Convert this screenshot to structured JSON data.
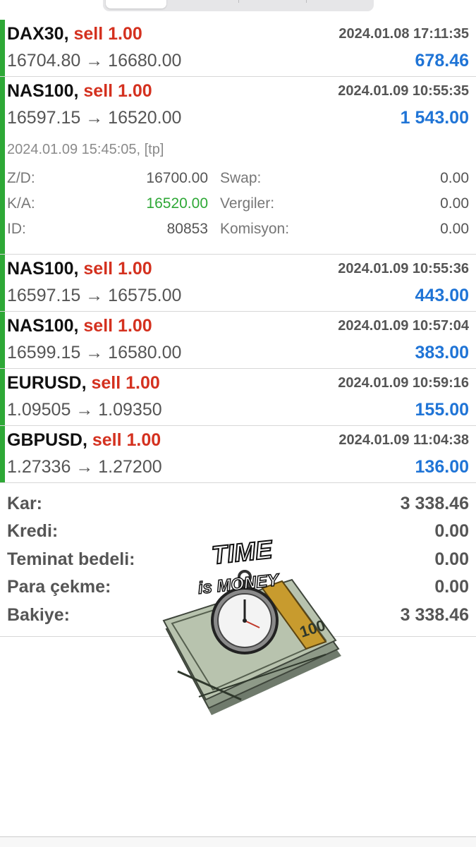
{
  "trades": [
    {
      "symbol": "DAX30,",
      "side": "sell 1.00",
      "datetime": "2024.01.08 17:11:35",
      "prices": "16704.80 → 16680.00",
      "profit": "678.46"
    },
    {
      "symbol": "NAS100,",
      "side": "sell 1.00",
      "datetime": "2024.01.09 10:55:35",
      "prices": "16597.15 → 16520.00",
      "profit": "1 543.00",
      "detail": {
        "close_line": "2024.01.09 15:45:05, [tp]",
        "rows": [
          {
            "label1": "Z/D:",
            "value1": "16700.00",
            "label2": "Swap:",
            "value2": "0.00"
          },
          {
            "label1": "K/A:",
            "value1": "16520.00",
            "label2": "Vergiler:",
            "value2": "0.00"
          },
          {
            "label1": "ID:",
            "value1": "80853",
            "label2": "Komisyon:",
            "value2": "0.00"
          }
        ]
      }
    },
    {
      "symbol": "NAS100,",
      "side": "sell 1.00",
      "datetime": "2024.01.09 10:55:36",
      "prices": "16597.15 → 16575.00",
      "profit": "443.00"
    },
    {
      "symbol": "NAS100,",
      "side": "sell 1.00",
      "datetime": "2024.01.09 10:57:04",
      "prices": "16599.15 → 16580.00",
      "profit": "383.00"
    },
    {
      "symbol": "EURUSD,",
      "side": "sell 1.00",
      "datetime": "2024.01.09 10:59:16",
      "prices": "1.09505 → 1.09350",
      "profit": "155.00"
    },
    {
      "symbol": "GBPUSD,",
      "side": "sell 1.00",
      "datetime": "2024.01.09 11:04:38",
      "prices": "1.27336 → 1.27200",
      "profit": "136.00"
    }
  ],
  "summary": [
    {
      "label": "Kar:",
      "value": "3 338.46"
    },
    {
      "label": "Kredi:",
      "value": "0.00"
    },
    {
      "label": "Teminat bedeli:",
      "value": "0.00"
    },
    {
      "label": "Para çekme:",
      "value": "0.00"
    },
    {
      "label": "Bakiye:",
      "value": "3 338.46"
    }
  ],
  "sticker": {
    "line1": "TIME",
    "line2": "is MONEY",
    "bill_value": "100"
  },
  "colors": {
    "sell": "#d4311f",
    "profit": "#1f74d6",
    "open_bar": "#2ea836",
    "tp_price": "#2ea836"
  }
}
